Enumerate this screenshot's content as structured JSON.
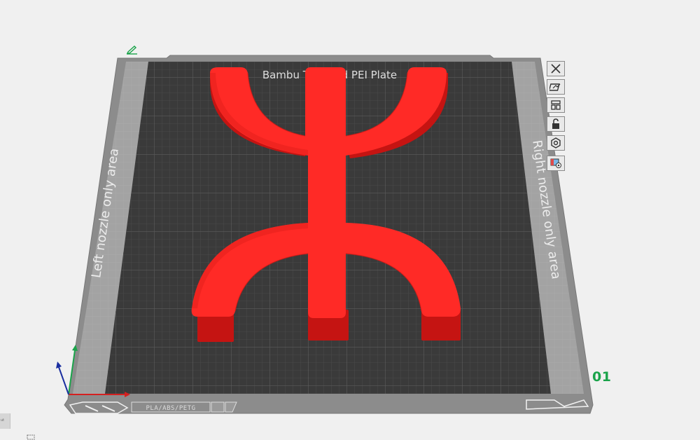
{
  "plate": {
    "name": "Bambu Textured PEI Plate",
    "left_area_label": "Left nozzle only area",
    "right_area_label": "Right nozzle only area",
    "filament_tag": "PLA/ABS/PETG",
    "plate_number": "01"
  },
  "model": {
    "shape": "Yaz (Tifinagh ⵣ) symbol",
    "color": "#ff2a26"
  },
  "toolbar": [
    {
      "name": "delete-plate-button",
      "icon": "close-icon"
    },
    {
      "name": "auto-orient-button",
      "icon": "orient-icon"
    },
    {
      "name": "arrange-button",
      "icon": "arrange-icon"
    },
    {
      "name": "lock-plate-button",
      "icon": "lock-icon"
    },
    {
      "name": "plate-settings-button",
      "icon": "gear-icon"
    },
    {
      "name": "plate-view-button",
      "icon": "plate-type-icon"
    }
  ],
  "side_hint": {
    "label": "ut"
  },
  "colors": {
    "background": "#f0f0f0",
    "plate_frame": "#8c8c8c",
    "plate_surface": "#3a3a3a",
    "nozzle_area": "#a3a3a3",
    "model": "#ff2a26",
    "axis_x": "#d42020",
    "axis_y": "#1aa34a",
    "axis_z": "#1a2ea0",
    "plate_number": "#1aa34a"
  }
}
